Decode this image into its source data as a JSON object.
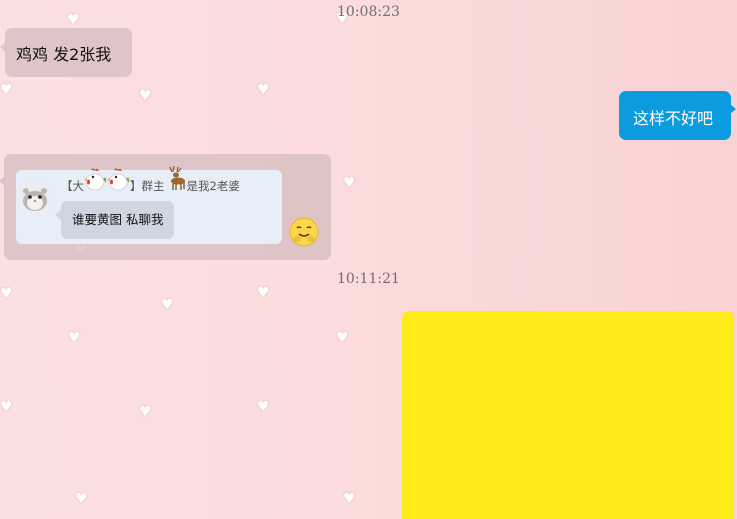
{
  "timestamps": [
    "10:08:23",
    "10:11:21"
  ],
  "messages": {
    "msg1": {
      "side": "left",
      "text": "鸡鸡 发2张我"
    },
    "msg2": {
      "side": "right",
      "text": "这样不好吧"
    },
    "msg3": {
      "side": "left",
      "quote": {
        "name_parts": [
          "【大",
          "】群主",
          "是我2老婆"
        ],
        "emojis": [
          "rooster-emoji",
          "rooster-emoji",
          "deer-emoji"
        ],
        "text": "谁要黄图 私聊我"
      },
      "reaction_icon": "grinning-cat-face-emoji"
    },
    "msg4": {
      "side": "right",
      "type": "image",
      "color": "#ffeb1a"
    }
  },
  "colors": {
    "right_bubble": "#0d9be0",
    "left_bubble": "#d6bec0",
    "background": "#fcdcdc",
    "quote_card": "#e8eef8"
  }
}
